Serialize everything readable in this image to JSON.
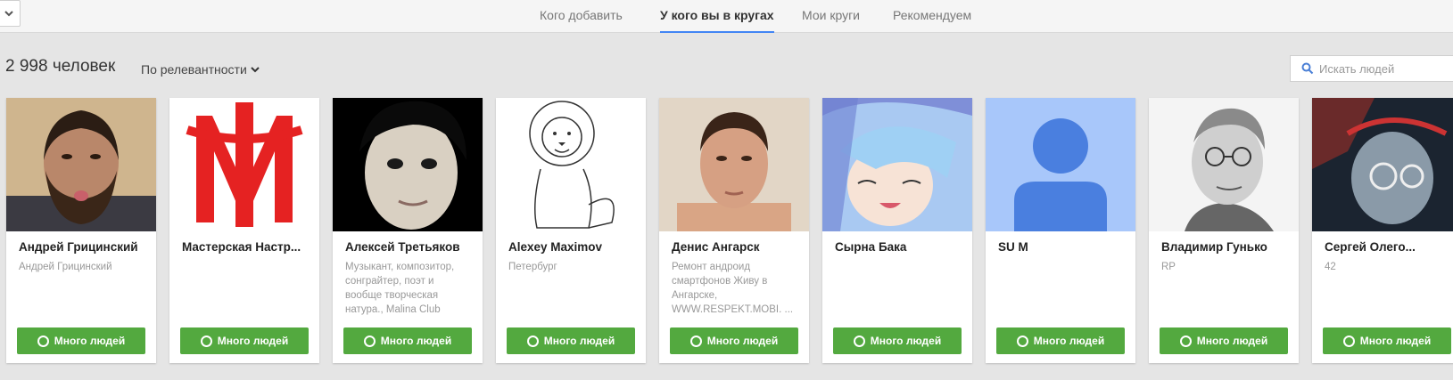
{
  "tabs": [
    {
      "label": "Кого добавить"
    },
    {
      "label": "У кого вы в кругах"
    },
    {
      "label": "Мои круги"
    },
    {
      "label": "Рекомендуем"
    }
  ],
  "active_tab": "У кого вы в кругах",
  "header": {
    "count": "2 998 человек",
    "sort_label": "По релевантности"
  },
  "search": {
    "placeholder": "Искать людей"
  },
  "colors": {
    "accent": "#4285f4",
    "button": "#53a93f"
  },
  "people": [
    {
      "name": "Андрей Грицинский",
      "subtitle": "Андрей Грицинский",
      "button": "Много людей"
    },
    {
      "name": "Мастерская Настр...",
      "subtitle": "",
      "button": "Много людей"
    },
    {
      "name": "Алексей Третьяков",
      "subtitle": "Музыкант, композитор, сонграйтер, поэт и вообще творческая натура., Malina Club",
      "button": "Много людей"
    },
    {
      "name": "Alexey Maximov",
      "subtitle": "Петербург",
      "button": "Много людей"
    },
    {
      "name": "Денис Ангарск",
      "subtitle": "Ремонт андроид смартфонов Живу в Ангарске, WWW.RESPEKT.MOBI. ...",
      "button": "Много людей"
    },
    {
      "name": "Сырна Бака",
      "subtitle": "",
      "button": "Много людей"
    },
    {
      "name": "SU M",
      "subtitle": "",
      "button": "Много людей"
    },
    {
      "name": "Владимир Гунько",
      "subtitle": "RP",
      "button": "Много людей"
    },
    {
      "name": "Сергей Олего...",
      "subtitle": "42",
      "button": "Много людей"
    }
  ]
}
